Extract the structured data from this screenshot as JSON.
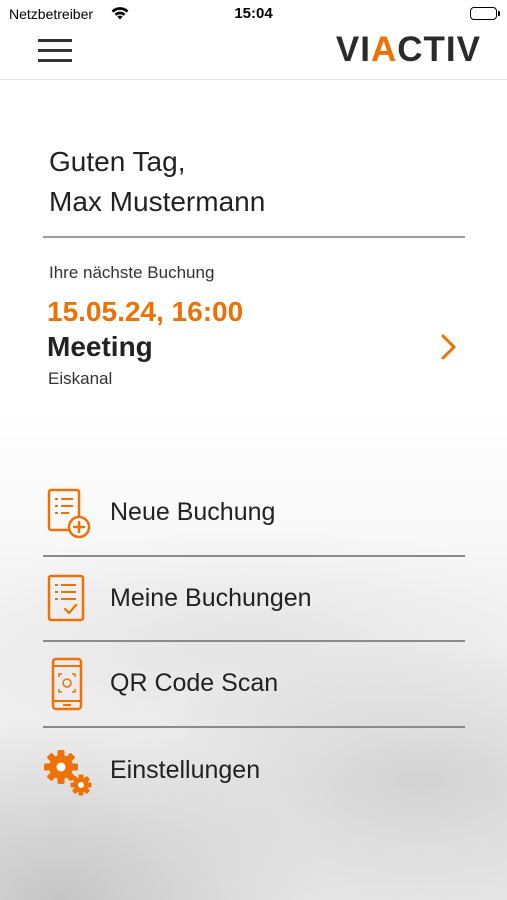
{
  "status_bar": {
    "carrier": "Netzbetreiber",
    "time": "15:04"
  },
  "header": {
    "logo_part1": "VI",
    "logo_accent": "A",
    "logo_part2": "CTIV"
  },
  "greeting": {
    "line1": "Guten Tag,",
    "line2": "Max Mustermann"
  },
  "next_booking": {
    "label": "Ihre nächste Buchung",
    "datetime": "15.05.24, 16:00",
    "title": "Meeting",
    "location": "Eiskanal"
  },
  "menu": {
    "items": [
      {
        "label": "Neue Buchung",
        "icon": "new-booking-icon"
      },
      {
        "label": "Meine Buchungen",
        "icon": "my-bookings-icon"
      },
      {
        "label": "QR Code Scan",
        "icon": "qr-scan-icon"
      },
      {
        "label": "Einstellungen",
        "icon": "settings-icon"
      }
    ]
  },
  "colors": {
    "accent": "#ee7203",
    "text": "#222222",
    "divider": "#9c9c9c"
  }
}
